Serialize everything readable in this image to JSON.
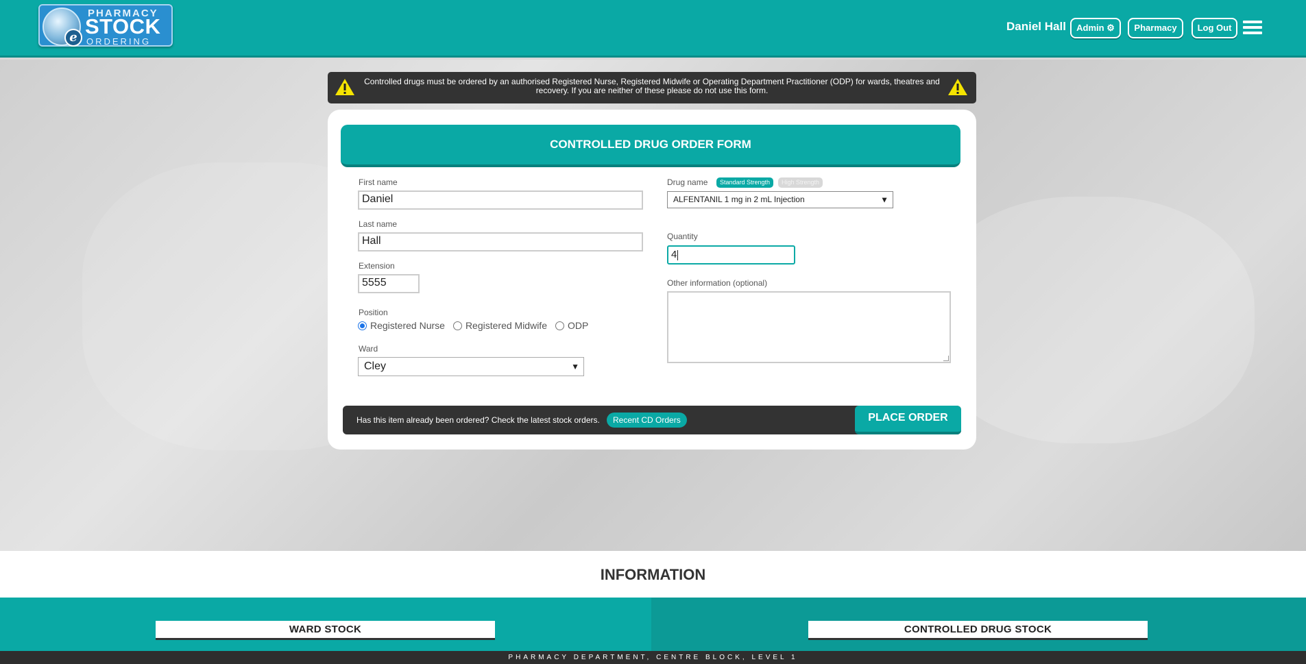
{
  "header": {
    "logo": {
      "line1": "PHARMACY",
      "line2": "STOCK",
      "line3": "ORDERING",
      "badge": "e"
    },
    "user_name": "Daniel Hall",
    "admin_label": "Admin",
    "pharmacy_label": "Pharmacy",
    "logout_label": "Log Out"
  },
  "warning": {
    "text": "Controlled drugs must be ordered by an authorised Registered Nurse, Registered Midwife or Operating Department Practitioner (ODP) for wards, theatres and recovery. If you are neither of these please do not use this form."
  },
  "form": {
    "title": "CONTROLLED DRUG ORDER FORM",
    "first_name_label": "First name",
    "first_name": "Daniel",
    "last_name_label": "Last name",
    "last_name": "Hall",
    "extension_label": "Extension",
    "extension": "5555",
    "position_label": "Position",
    "positions": [
      "Registered Nurse",
      "Registered Midwife",
      "ODP"
    ],
    "position_selected": "Registered Nurse",
    "ward_label": "Ward",
    "ward": "Cley",
    "drug_label": "Drug name",
    "badge_standard": "Standard Strength",
    "badge_high": "High Strength",
    "drug": "ALFENTANIL 1 mg in 2 mL Injection",
    "quantity_label": "Quantity",
    "quantity": "4",
    "other_label": "Other information (optional)",
    "other": ""
  },
  "bottom_bar": {
    "text": "Has this item already been ordered? Check the latest stock orders.",
    "recent_label": "Recent CD Orders",
    "place_label": "PLACE ORDER"
  },
  "info": {
    "title": "INFORMATION",
    "ward_stock": "WARD STOCK",
    "cd_stock": "CONTROLLED DRUG STOCK"
  },
  "footer": {
    "text": "PHARMACY DEPARTMENT, CENTRE BLOCK, LEVEL 1"
  },
  "colors": {
    "teal": "#0aa9a5",
    "dark": "#333333"
  }
}
